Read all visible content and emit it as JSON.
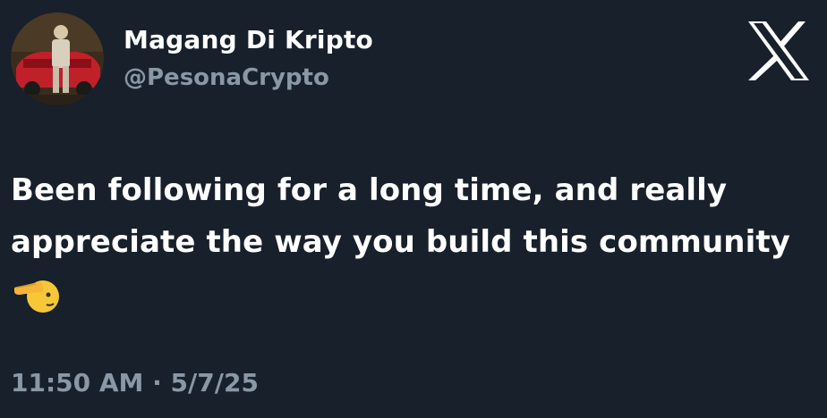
{
  "post": {
    "author": {
      "display_name": "Magang Di Kripto",
      "handle": "@PesonaCrypto",
      "avatar_icon": "profile-photo-person-with-red-car"
    },
    "text_lines": [
      "Been following for a long time, and really",
      "appreciate the way you build this community"
    ],
    "emoji": "saluting-face-emoji",
    "timestamp": "11:50 AM · 5/7/25"
  },
  "brand": {
    "logo": "x-logo-icon",
    "background_color": "#17202b",
    "text_color": "#ffffff",
    "muted_color": "#8a97a4"
  }
}
